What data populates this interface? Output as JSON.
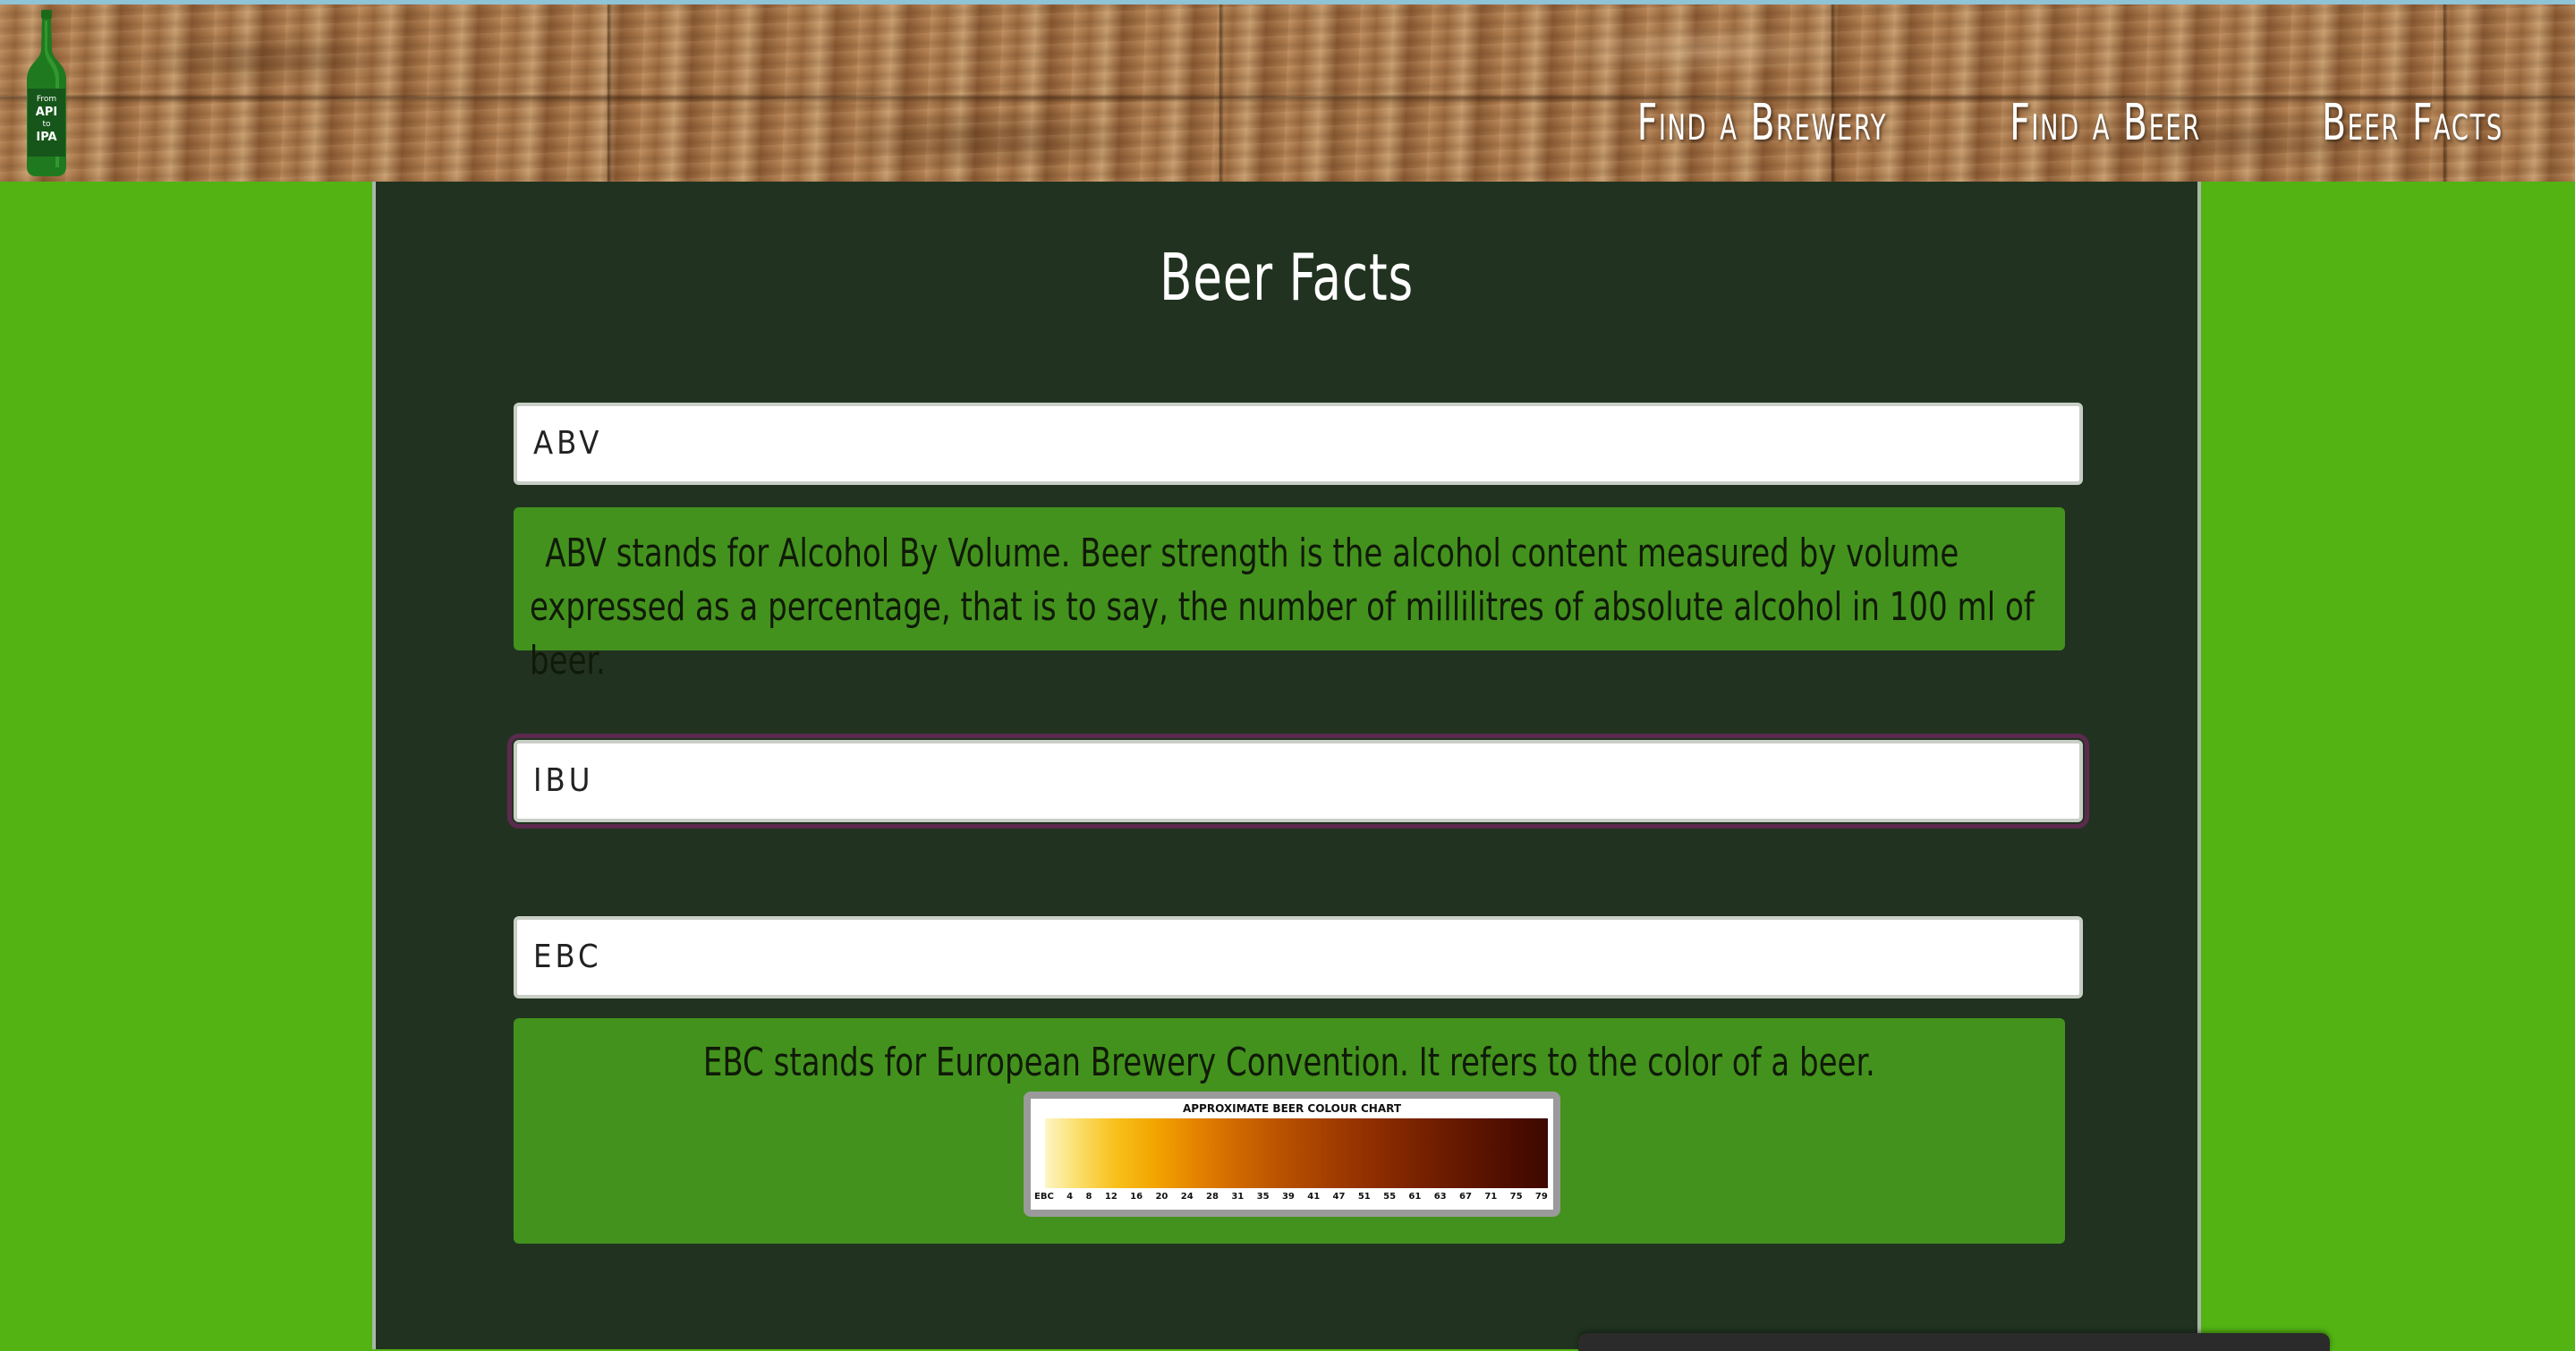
{
  "logo": {
    "line1": "From",
    "line2": "API",
    "line3": "to",
    "line4": "IPA"
  },
  "nav": {
    "find_brewery": "Find a Brewery",
    "find_beer": "Find a Beer",
    "beer_facts": "Beer Facts"
  },
  "page": {
    "title": "Beer Facts"
  },
  "facts": {
    "abv": {
      "label": "ABV",
      "text": "ABV stands for Alcohol By Volume. Beer strength is the alcohol content measured by volume expressed as a percentage, that is to say, the number of millilitres of absolute alcohol in 100 ml of beer."
    },
    "ibu": {
      "label": "IBU"
    },
    "ebc": {
      "label": "EBC",
      "text": "EBC stands for European Brewery Convention. It refers to the color of a beer.",
      "chart_title": "APPROXIMATE BEER COLOUR CHART",
      "scale_label": "EBC",
      "scale": [
        "4",
        "8",
        "12",
        "16",
        "20",
        "24",
        "28",
        "31",
        "35",
        "39",
        "41",
        "47",
        "51",
        "55",
        "61",
        "63",
        "67",
        "71",
        "75",
        "79"
      ]
    }
  },
  "colors": {
    "page_background": "#52b313",
    "panel_background": "#213320",
    "fact_box_background": "#43921d",
    "focus_outline": "#5b2a4e"
  }
}
